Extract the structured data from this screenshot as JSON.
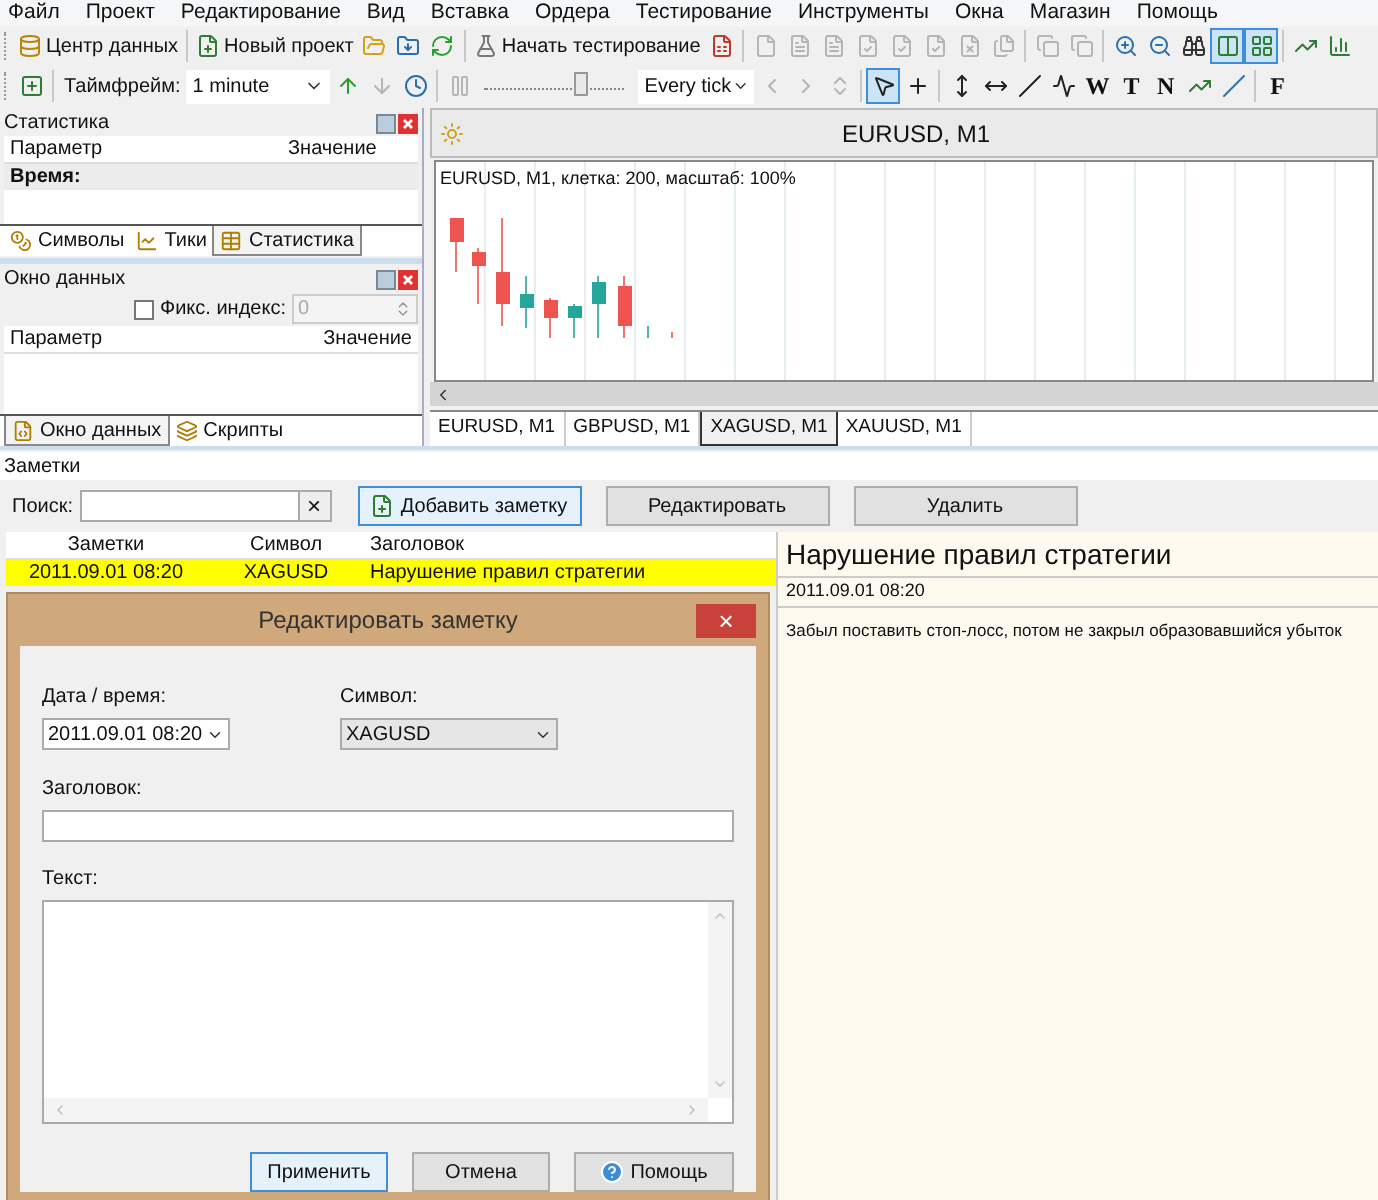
{
  "menu": [
    "Файл",
    "Проект",
    "Редактирование",
    "Вид",
    "Вставка",
    "Ордера",
    "Тестирование",
    "Инструменты",
    "Окна",
    "Магазин",
    "Помощь"
  ],
  "toolbar1": [
    {
      "kind": "labeled",
      "label": "Центр данных",
      "pressed": false,
      "disabled": false
    },
    {
      "kind": "separator"
    },
    {
      "kind": "labeled",
      "label": "Новый проект",
      "pressed": false,
      "disabled": false
    },
    {
      "kind": "icon",
      "pressed": false,
      "disabled": false
    },
    {
      "kind": "icon",
      "pressed": false,
      "disabled": false
    },
    {
      "kind": "icon",
      "pressed": false,
      "disabled": false
    },
    {
      "kind": "separator"
    },
    {
      "kind": "labeled",
      "label": "Начать тестирование",
      "pressed": false,
      "disabled": false
    },
    {
      "kind": "icon",
      "pressed": false,
      "disabled": false
    },
    {
      "kind": "separator"
    },
    {
      "kind": "icon",
      "pressed": false,
      "disabled": true
    },
    {
      "kind": "icon",
      "pressed": false,
      "disabled": true
    },
    {
      "kind": "icon",
      "pressed": false,
      "disabled": true
    },
    {
      "kind": "icon",
      "pressed": false,
      "disabled": true
    },
    {
      "kind": "icon",
      "pressed": false,
      "disabled": true
    },
    {
      "kind": "icon",
      "pressed": false,
      "disabled": true
    },
    {
      "kind": "icon",
      "pressed": false,
      "disabled": true
    },
    {
      "kind": "icon",
      "pressed": false,
      "disabled": true
    },
    {
      "kind": "separator"
    },
    {
      "kind": "icon",
      "pressed": false,
      "disabled": true
    },
    {
      "kind": "icon",
      "pressed": false,
      "disabled": true
    },
    {
      "kind": "separator"
    },
    {
      "kind": "icon",
      "pressed": false,
      "disabled": false
    },
    {
      "kind": "icon",
      "pressed": false,
      "disabled": false
    },
    {
      "kind": "icon",
      "pressed": false,
      "disabled": false
    },
    {
      "kind": "icon",
      "pressed": true,
      "disabled": false
    },
    {
      "kind": "icon",
      "pressed": true,
      "disabled": false
    },
    {
      "kind": "separator"
    },
    {
      "kind": "icon",
      "pressed": false,
      "disabled": false
    },
    {
      "kind": "icon",
      "pressed": false,
      "disabled": false
    }
  ],
  "toolbar2": [
    {
      "kind": "icon",
      "pressed": false,
      "disabled": false
    },
    {
      "kind": "separator"
    },
    {
      "kind": "text",
      "label": "Таймфрейм:"
    },
    {
      "kind": "combo",
      "value": "1 minute"
    },
    {
      "kind": "icon",
      "pressed": false,
      "disabled": false
    },
    {
      "kind": "icon",
      "pressed": false,
      "disabled": true
    },
    {
      "kind": "icon",
      "pressed": false,
      "disabled": false
    },
    {
      "kind": "separator"
    },
    {
      "kind": "icon",
      "pressed": false,
      "disabled": true
    },
    {
      "kind": "slider",
      "level": 0.68
    },
    {
      "kind": "combo",
      "value": "Every tick"
    },
    {
      "kind": "icon",
      "pressed": false,
      "disabled": true
    },
    {
      "kind": "icon",
      "pressed": false,
      "disabled": true
    },
    {
      "kind": "icon",
      "pressed": false,
      "disabled": true
    },
    {
      "kind": "separator"
    },
    {
      "kind": "icon",
      "pressed": true,
      "disabled": false
    },
    {
      "kind": "icon",
      "pressed": false,
      "disabled": false
    },
    {
      "kind": "separator"
    },
    {
      "kind": "icon",
      "pressed": false,
      "disabled": false
    },
    {
      "kind": "icon",
      "pressed": false,
      "disabled": false
    },
    {
      "kind": "icon",
      "pressed": false,
      "disabled": false
    },
    {
      "kind": "icon",
      "pressed": false,
      "disabled": false
    },
    {
      "kind": "glyph",
      "label": "W",
      "pressed": false
    },
    {
      "kind": "glyph",
      "label": "T",
      "pressed": false
    },
    {
      "kind": "glyph",
      "label": "N",
      "pressed": false
    },
    {
      "kind": "icon",
      "pressed": false,
      "disabled": false
    },
    {
      "kind": "icon",
      "pressed": false,
      "disabled": false
    },
    {
      "kind": "separator"
    },
    {
      "kind": "glyph",
      "label": "F",
      "pressed": false
    }
  ],
  "statistics_panel": {
    "title": "Статистика",
    "columns": [
      "Параметр",
      "Значение"
    ],
    "rows": [
      "Время:"
    ],
    "tabs": [
      {
        "label": "Символы",
        "selected": false
      },
      {
        "label": "Тики",
        "selected": false
      },
      {
        "label": "Статистика",
        "selected": true
      }
    ]
  },
  "data_window": {
    "title": "Окно данных",
    "fix_index": {
      "label": "Фикс. индекс:",
      "checked": false,
      "value": "0",
      "field_disabled": true
    },
    "columns": [
      "Параметр",
      "Значение"
    ],
    "tabs": [
      {
        "label": "Окно данных",
        "selected": true
      },
      {
        "label": "Скрипты",
        "selected": false
      }
    ]
  },
  "chart_window": {
    "title": "EURUSD, M1",
    "info": "EURUSD, M1, клетка: 200, масштаб: 100%",
    "tabs": [
      {
        "label": "EURUSD, M1",
        "selected": false
      },
      {
        "label": "GBPUSD, M1",
        "selected": false
      },
      {
        "label": "XAGUSD, M1",
        "selected": true
      },
      {
        "label": "XAUUSD, M1",
        "selected": false
      }
    ]
  },
  "notes": {
    "title": "Заметки",
    "search_label": "Поиск:",
    "clear": "×",
    "buttons": [
      {
        "label": "Добавить заметку",
        "focused": true
      },
      {
        "label": "Редактировать",
        "focused": false
      },
      {
        "label": "Удалить",
        "focused": false
      }
    ],
    "columns": [
      "Заметки",
      "Символ",
      "Заголовок"
    ],
    "rows": [
      {
        "date": "2011.09.01 08:20",
        "symbol": "XAGUSD",
        "title": "Нарушение правил стратегии",
        "selected": true
      }
    ],
    "preview": {
      "title": "Нарушение правил стратегии",
      "date": "2011.09.01 08:20",
      "body": "Забыл поставить стоп-лосс, потом не закрыл образовавшийся убыток"
    }
  },
  "dialog": {
    "title": "Редактировать заметку",
    "close": "×",
    "date_label": "Дата / время:",
    "date_value": "2011.09.01 08:20",
    "symbol_label": "Символ:",
    "symbol_value": "XAGUSD",
    "heading_label": "Заголовок:",
    "text_label": "Текст:",
    "buttons": [
      {
        "kind": "apply",
        "label": "Применить",
        "focused": true
      },
      {
        "kind": "cancel",
        "label": "Отмена",
        "focused": false
      },
      {
        "kind": "help",
        "label": "Помощь",
        "focused": false
      }
    ]
  }
}
